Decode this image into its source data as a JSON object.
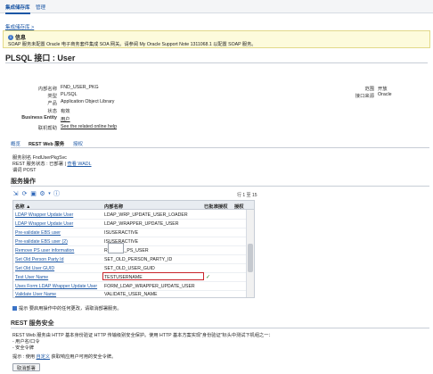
{
  "top_tabs": [
    "集成储存库",
    "管理"
  ],
  "breadcrumb": "集成储存库 >",
  "info": {
    "title": "信息",
    "text": "SOAP 服务未配置 Oracle 电子商务套件集成 SOA 网关。请参阅 My Oracle Support Note 1311068.1 以配置 SOAP 服务。"
  },
  "page_title": "PLSQL 接口 : User",
  "details": {
    "internal_name_label": "内部名称",
    "internal_name": "FND_USER_PKG",
    "type_label": "类型",
    "type": "PL/SQL",
    "product_label": "产品",
    "product": "Application Object Library",
    "status_label": "状态",
    "status": "有效",
    "business_entity_label": "Business Entity",
    "business_entity": "用户",
    "online_help_label": "联机帮助",
    "online_help": "See the related online help",
    "scope_label": "范围",
    "scope": "开放",
    "interface_source_label": "接口来源",
    "interface_source": "Oracle"
  },
  "sub_tabs": [
    "概览",
    "REST Web 服务",
    "授权"
  ],
  "service": {
    "alias_label": "服务别名",
    "alias": "FndUserPkgSvc",
    "status_label": "REST 服务状态 : ",
    "status": "已部署",
    "view_wadl": "查看 WADL",
    "verb_label": "谓词",
    "verb": "POST"
  },
  "operations_title": "服务操作",
  "pager": "行 1 至 15",
  "table": {
    "headers": [
      "名称 ▲",
      "内部名称",
      "已批准授权",
      "授权"
    ],
    "rows": [
      {
        "name": "LDAP Wrapper Update User",
        "internal": "LDAP_WRP_UPDATE_USER_LOADER",
        "check": ""
      },
      {
        "name": "LDAP Wrapper Update User",
        "internal": "LDAP_WRAPPER_UPDATE_USER",
        "check": ""
      },
      {
        "name": "Pre-validate EBS user",
        "internal": "ISUSERACTIVE",
        "check": ""
      },
      {
        "name": "Pre-validate EBS user (2)",
        "internal": "ISUSERACTIVE",
        "check": ""
      },
      {
        "name": "Remove PS user information",
        "internal": "REMOVE_PS_USER",
        "check": ""
      },
      {
        "name": "Set Old Person Party Id",
        "internal": "SET_OLD_PERSON_PARTY_ID",
        "check": ""
      },
      {
        "name": "Set Old User GUID",
        "internal": "SET_OLD_USER_GUID",
        "check": ""
      },
      {
        "name": "Test User Name",
        "internal": "TESTUSERNAME",
        "check": "✓"
      },
      {
        "name": "Uses Form LDAP Wrapper Update User",
        "internal": "FORM_LDAP_WRAPPER_UPDATE_USER",
        "check": ""
      },
      {
        "name": "Validate User Name",
        "internal": "VALIDATE_USER_NAME",
        "check": ""
      }
    ]
  },
  "hint": "提示 要启用操作中的任何更改，请取消部署服务。",
  "security_title": "REST 服务安全",
  "security": {
    "line1": "REST Web 服务由 HTTP 基本身份验证 HTTP 传输级别安全保护。使用 HTTP 基本方案实现\"身份验证\"标头中测试下机组之一：",
    "line2": "- 用户名/口令",
    "line3": "- 安全令牌",
    "tip_prefix": "提示 : 使用 ",
    "tip_link": "自定义",
    "tip_suffix": " 获取响应用户可用的安全令牌。"
  },
  "undeploy_button": "取消部署",
  "icons": [
    "export-icon",
    "refresh-icon",
    "settings-icon",
    "detach-icon",
    "info-icon",
    "scroll-thumb"
  ]
}
